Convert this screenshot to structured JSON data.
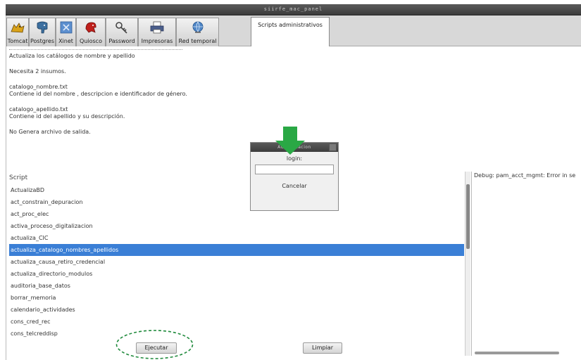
{
  "window": {
    "title": "siirfe_mac_panel"
  },
  "tabs": [
    {
      "label": "Tomcat",
      "icon": "tomcat-icon"
    },
    {
      "label": "Postgres",
      "icon": "postgres-elephant-icon"
    },
    {
      "label": "Xinet",
      "icon": "xinet-icon"
    },
    {
      "label": "Quiosco",
      "icon": "kiosk-icon"
    },
    {
      "label": "Password",
      "icon": "key-icon"
    },
    {
      "label": "Impresoras",
      "icon": "printer-icon"
    },
    {
      "label": "Red temporal",
      "icon": "network-globe-icon"
    },
    {
      "label": "Scripts administrativos",
      "active": true
    }
  ],
  "description": {
    "line1": "Actualiza los catálogos de nombre y apellido",
    "line2": "Necesita 2 insumos.",
    "line3": "catalogo_nombre.txt",
    "line4": "Contiene id del nombre  , descripcion e identificador de género.",
    "line5": "catalogo_apellido.txt",
    "line6": "Contiene id del apellido y su descripción.",
    "line7": "No Genera archivo de salida."
  },
  "script_list": {
    "header": "Script",
    "items": [
      "ActualizaBD",
      "act_constrain_depuracion",
      "act_proc_elec",
      "activa_proceso_digitalizacion",
      "actualiza_CIC",
      "actualiza_catalogo_nombres_apellidos",
      "actualiza_causa_retiro_credencial",
      "actualiza_directorio_modulos",
      "auditoria_base_datos",
      "borrar_memoria",
      "calendario_actividades",
      "cons_cred_rec",
      "cons_telcreddisp"
    ],
    "selected_index": 5
  },
  "log": {
    "text": "Debug: pam_acct_mgmt: Error in se"
  },
  "buttons": {
    "run": "Ejecutar",
    "clear": "Limpiar"
  },
  "auth_dialog": {
    "title": "Autenticacion",
    "label": "login:",
    "input_value": "",
    "cancel": "Cancelar"
  },
  "colors": {
    "selection": "#3a7fd6",
    "annotation_arrow": "#2aa845",
    "annotation_ring": "#1f8a3c"
  }
}
